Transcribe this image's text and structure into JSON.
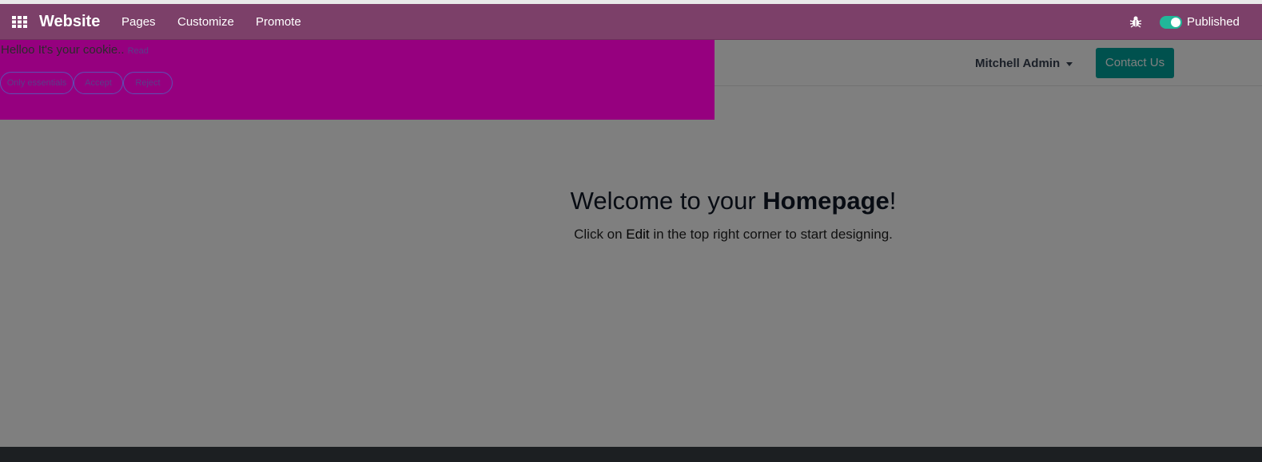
{
  "navbar": {
    "brand": "Website",
    "items": [
      {
        "label": "Pages"
      },
      {
        "label": "Customize"
      },
      {
        "label": "Promote"
      }
    ],
    "published_label": "Published",
    "published_on": true,
    "colors": {
      "bar": "#7c4069",
      "toggle": "#21b799"
    }
  },
  "site_header": {
    "user": "Mitchell Admin",
    "contact_label": "Contact Us"
  },
  "hero": {
    "title_prefix": "Welcome to your ",
    "title_bold": "Homepage",
    "title_suffix": "!",
    "sub_prefix": "Click on ",
    "sub_bold": "Edit",
    "sub_suffix": " in the top right corner to start designing."
  },
  "cookie_bar": {
    "message": "Helloo It's your cookie..",
    "read_label": "Read",
    "buttons": [
      {
        "label": "Only essentials"
      },
      {
        "label": "Accept"
      },
      {
        "label": "Reject"
      }
    ],
    "color": "#96007f"
  },
  "icons": [
    "apps-grid-icon",
    "bug-icon"
  ]
}
